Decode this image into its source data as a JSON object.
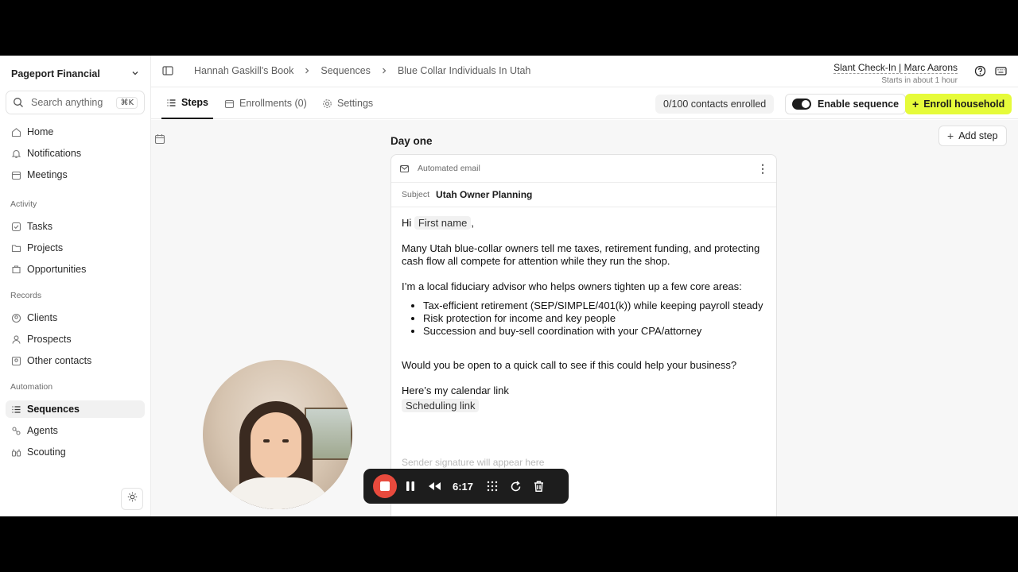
{
  "sidebar": {
    "org_name": "Pageport Financial",
    "search_placeholder": "Search anything",
    "search_shortcut": "⌘K",
    "main": [
      {
        "label": "Home"
      },
      {
        "label": "Notifications"
      },
      {
        "label": "Meetings"
      }
    ],
    "activity_label": "Activity",
    "activity": [
      {
        "label": "Tasks"
      },
      {
        "label": "Projects"
      },
      {
        "label": "Opportunities"
      }
    ],
    "records_label": "Records",
    "records": [
      {
        "label": "Clients"
      },
      {
        "label": "Prospects"
      },
      {
        "label": "Other contacts"
      }
    ],
    "automation_label": "Automation",
    "automation": [
      {
        "label": "Sequences",
        "active": true
      },
      {
        "label": "Agents"
      },
      {
        "label": "Scouting"
      }
    ]
  },
  "breadcrumb": [
    "Hannah Gaskill's Book",
    "Sequences",
    "Blue Collar Individuals In Utah"
  ],
  "meeting": {
    "title": "Slant Check-In | Marc Aarons",
    "subtitle": "Starts in about 1 hour"
  },
  "tabs": [
    {
      "label": "Steps",
      "active": true
    },
    {
      "label": "Enrollments (0)"
    },
    {
      "label": "Settings"
    }
  ],
  "toolbar": {
    "enrolled_count": "0/100 contacts enrolled",
    "enable_label": "Enable sequence",
    "enable_on": true,
    "enroll_label": "Enroll household",
    "add_step_label": "Add step"
  },
  "step": {
    "day_label": "Day one",
    "type_label": "Automated email",
    "subject_label": "Subject",
    "subject_value": "Utah Owner Planning",
    "greeting": "Hi",
    "first_name_token": "First name",
    "greeting_comma": ",",
    "para1": "Many Utah blue-collar owners tell me taxes, retirement funding, and protecting cash flow all compete for attention while they run the shop.",
    "para2": "I’m a local fiduciary advisor who helps owners tighten up a few core areas:",
    "bullets": [
      "Tax-efficient retirement (SEP/SIMPLE/401(k)) while keeping payroll steady",
      "Risk protection for income and key people",
      "Succession and buy-sell coordination with your CPA/attorney"
    ],
    "para3": "Would you be open to a quick call to see if this could help your business?",
    "calendar_line": "Here’s my calendar link",
    "scheduling_token": "Scheduling link",
    "signature_placeholder": "Sender signature will appear here"
  },
  "recorder": {
    "time": "6:17"
  },
  "colors": {
    "accent": "#e6fb3a",
    "record": "#e84a3d"
  }
}
